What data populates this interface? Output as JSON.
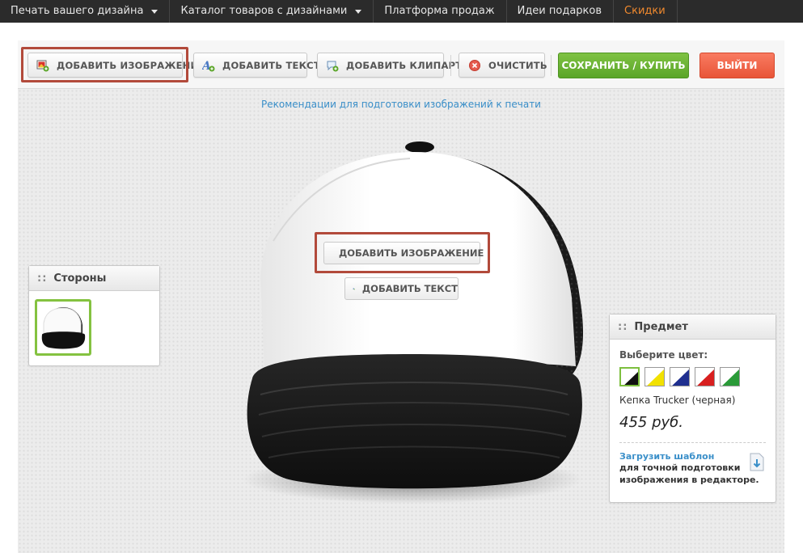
{
  "nav": {
    "items": [
      {
        "label": "Печать вашего дизайна"
      },
      {
        "label": "Каталог товаров с дизайнами"
      },
      {
        "label": "Платформа продаж"
      },
      {
        "label": "Идеи подарков"
      },
      {
        "label": "Скидки"
      }
    ]
  },
  "toolbar": {
    "add_image": "ДОБАВИТЬ ИЗОБРАЖЕНИЕ",
    "add_text": "ДОБАВИТЬ ТЕКСТ",
    "add_clipart": "ДОБАВИТЬ КЛИПАРТ",
    "clear": "ОЧИСТИТЬ",
    "save": "СОХРАНИТЬ / КУПИТЬ",
    "exit": "ВЫЙТИ"
  },
  "canvas": {
    "recommendation_link": "Рекомендации для подготовки изображений к печати",
    "add_image": "ДОБАВИТЬ ИЗОБРАЖЕНИЕ",
    "add_text": "ДОБАВИТЬ ТЕКСТ"
  },
  "sides_panel": {
    "title": "Стороны",
    "handle": "::"
  },
  "item_panel": {
    "title": "Предмет",
    "handle": "::",
    "choose_color": "Выберите цвет:",
    "colors": [
      "#111111",
      "#f2e100",
      "#1f2f8f",
      "#d81f1f",
      "#2a9a38"
    ],
    "product_name": "Кепка Trucker (черная)",
    "price": "455 руб.",
    "template_link": "Загрузить шаблон",
    "template_text_1": "для точной подготовки",
    "template_text_2": "изображения в редакторе."
  },
  "colors": {
    "accent_nav": "#f28a2e",
    "save_green": "#5aa528",
    "exit_red": "#e85538",
    "link_blue": "#3a8fc9",
    "highlight": "#b24a3b"
  }
}
